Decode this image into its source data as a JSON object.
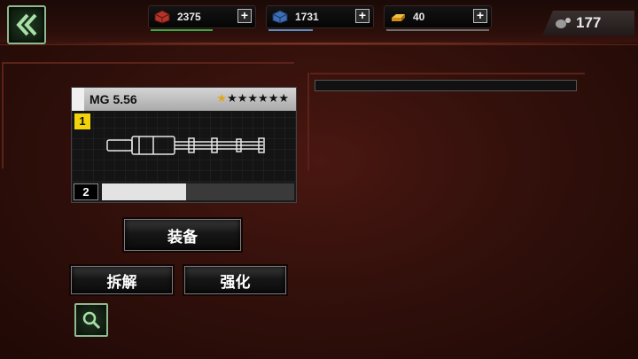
{
  "resources": [
    {
      "name": "supply-crates",
      "value": "2375",
      "color": "#c0392b",
      "bar_color": "#3aa84a",
      "fill": 0.55
    },
    {
      "name": "blue-crates",
      "value": "1731",
      "color": "#3d6fb8",
      "bar_color": "#5a8fc6",
      "fill": 0.35
    },
    {
      "name": "gold-bars",
      "value": "40",
      "color": "#e0a020",
      "bar_color": "#9e9e9e",
      "fill": 0.0
    }
  ],
  "grenades": {
    "count": "177"
  },
  "weapon": {
    "name": "MG 5.56",
    "stars_filled": 1,
    "stars_total": 7,
    "slot": "1",
    "level": "2",
    "xp_fraction": 0.44
  },
  "buttons": {
    "equip": "装备",
    "dismantle": "拆解",
    "upgrade": "强化"
  },
  "colors": {
    "accent_green": "#8fb98f",
    "star_gold": "#e3a51a",
    "slot_yellow": "#f1d20c"
  }
}
